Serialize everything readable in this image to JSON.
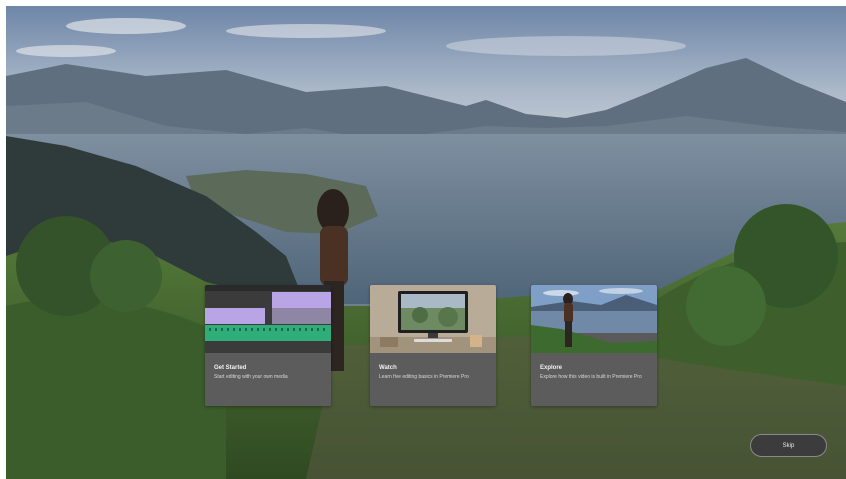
{
  "colors": {
    "sky": "#8fa3bd",
    "lake": "#5d7084",
    "foliage": "#3f6a2f",
    "card_bg": "#5c5c5c",
    "card_title": "#f2f2f2",
    "card_desc": "#d9d9d9",
    "skip_bg": "#3c3c3c",
    "timeline_purple": "#b9a5e6",
    "timeline_green": "#2fae7a"
  },
  "cards": [
    {
      "title": "Get Started",
      "description": "Start editing with your own media",
      "thumbnail": "timeline-thumbnail"
    },
    {
      "title": "Watch",
      "description": "Learn five editing basics in Premiere Pro",
      "thumbnail": "monitor-thumbnail"
    },
    {
      "title": "Explore",
      "description": "Explore how this video is built in Premiere Pro",
      "thumbnail": "landscape-thumbnail"
    }
  ],
  "skip_button": {
    "label": "Skip"
  }
}
